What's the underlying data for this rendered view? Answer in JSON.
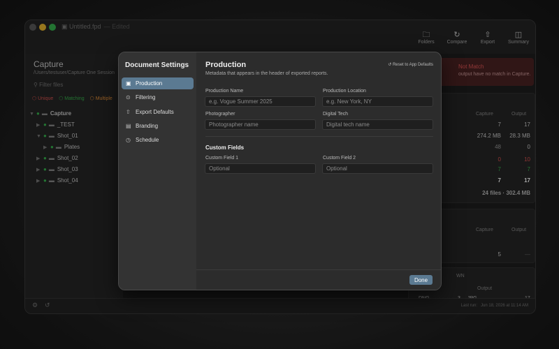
{
  "window": {
    "title": "Untitled.fpd",
    "edited": "— Edited",
    "toolbar": [
      {
        "label": "Folders",
        "icon": "folders-icon"
      },
      {
        "label": "Compare",
        "icon": "compare-icon"
      },
      {
        "label": "Export",
        "icon": "export-icon"
      },
      {
        "label": "Summary",
        "icon": "summary-icon"
      }
    ]
  },
  "sidebar": {
    "title": "Capture",
    "path": "/Users/testuser/Capture One Session",
    "filter_placeholder": "Filter files",
    "chips": [
      {
        "label": "Unique",
        "color": "#d9534f"
      },
      {
        "label": "Matching",
        "color": "#37b24d"
      },
      {
        "label": "Multiple",
        "color": "#e8913a"
      }
    ],
    "tree": [
      {
        "label": "Capture",
        "depth": 0,
        "expanded": true
      },
      {
        "label": "_TEST",
        "depth": 1,
        "expanded": false
      },
      {
        "label": "Shot_01",
        "depth": 1,
        "expanded": true
      },
      {
        "label": "Plates",
        "depth": 2,
        "expanded": false
      },
      {
        "label": "Shot_02",
        "depth": 1,
        "expanded": false
      },
      {
        "label": "Shot_03",
        "depth": 1,
        "expanded": false
      },
      {
        "label": "Shot_04",
        "depth": 1,
        "expanded": false
      }
    ]
  },
  "right_panel": {
    "not_match_title": "Not Match",
    "not_match_sub": "output have no match in Capture.",
    "card1": {
      "col_capture": "Capture",
      "col_output": "Output",
      "rows": [
        {
          "capture": "7",
          "output": "17",
          "color": "#cccccc"
        },
        {
          "capture": "274.2 MB",
          "output": "28.3 MB",
          "color": "#cccccc"
        },
        {
          "capture": "48",
          "output": "0",
          "color": "#cccccc"
        },
        {
          "capture": "0",
          "output": "10",
          "color": "#d9534f"
        },
        {
          "capture": "7",
          "output": "7",
          "color": "#37b24d"
        },
        {
          "capture": "7",
          "output": "17",
          "color": "#ffffff"
        }
      ],
      "total": "24 files · 302.4 MB"
    },
    "card2": {
      "col_capture": "Capture",
      "col_output": "Output",
      "capture": "5",
      "output": "—"
    },
    "card3": {
      "header": "WN",
      "col_output": "Output",
      "row": {
        "a": "DNG",
        "b": "3",
        "c": "JPG",
        "d": "17"
      }
    }
  },
  "statusbar": {
    "last_run_label": "Last run:",
    "last_run_value": "Jun 18, 2026 at 11:14 AM"
  },
  "modal": {
    "sidebar_title": "Document Settings",
    "nav": [
      {
        "label": "Production",
        "icon": "id-card-icon",
        "active": true
      },
      {
        "label": "Filtering",
        "icon": "filter-icon",
        "active": false
      },
      {
        "label": "Export Defaults",
        "icon": "export-icon",
        "active": false
      },
      {
        "label": "Branding",
        "icon": "image-icon",
        "active": false
      },
      {
        "label": "Schedule",
        "icon": "clock-icon",
        "active": false
      }
    ],
    "title": "Production",
    "subtitle": "Metadata that appears in the header of exported reports.",
    "reset_label": "Reset to App Defaults",
    "fields": {
      "production_name": {
        "label": "Production Name",
        "placeholder": "e.g. Vogue Summer 2025",
        "value": ""
      },
      "production_location": {
        "label": "Production Location",
        "placeholder": "e.g. New York, NY",
        "value": ""
      },
      "photographer": {
        "label": "Photographer",
        "placeholder": "Photographer name",
        "value": ""
      },
      "digital_tech": {
        "label": "Digital Tech",
        "placeholder": "Digital tech name",
        "value": ""
      }
    },
    "custom_title": "Custom Fields",
    "custom": {
      "field1": {
        "label": "Custom Field 1",
        "placeholder": "Optional",
        "value": ""
      },
      "field2": {
        "label": "Custom Field 2",
        "placeholder": "Optional",
        "value": ""
      }
    },
    "done_label": "Done",
    "colors": {
      "accent": "#5b7a92"
    }
  }
}
